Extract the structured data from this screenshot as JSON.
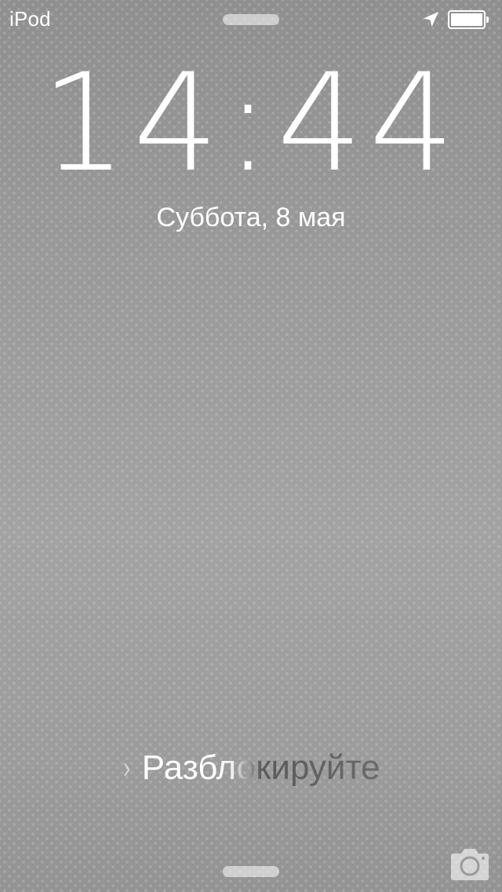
{
  "status_bar": {
    "carrier": "iPod",
    "location_icon": "location-arrow-icon",
    "battery_icon": "battery-icon",
    "battery_level": 1.0
  },
  "lock_screen": {
    "time": "14:44",
    "date": "Суббота, 8 мая",
    "unlock_chevron": "›",
    "unlock_text": "Разблокируйте",
    "camera_icon": "camera-icon"
  },
  "colors": {
    "background": "#9c9c9c",
    "text": "#ffffff"
  }
}
